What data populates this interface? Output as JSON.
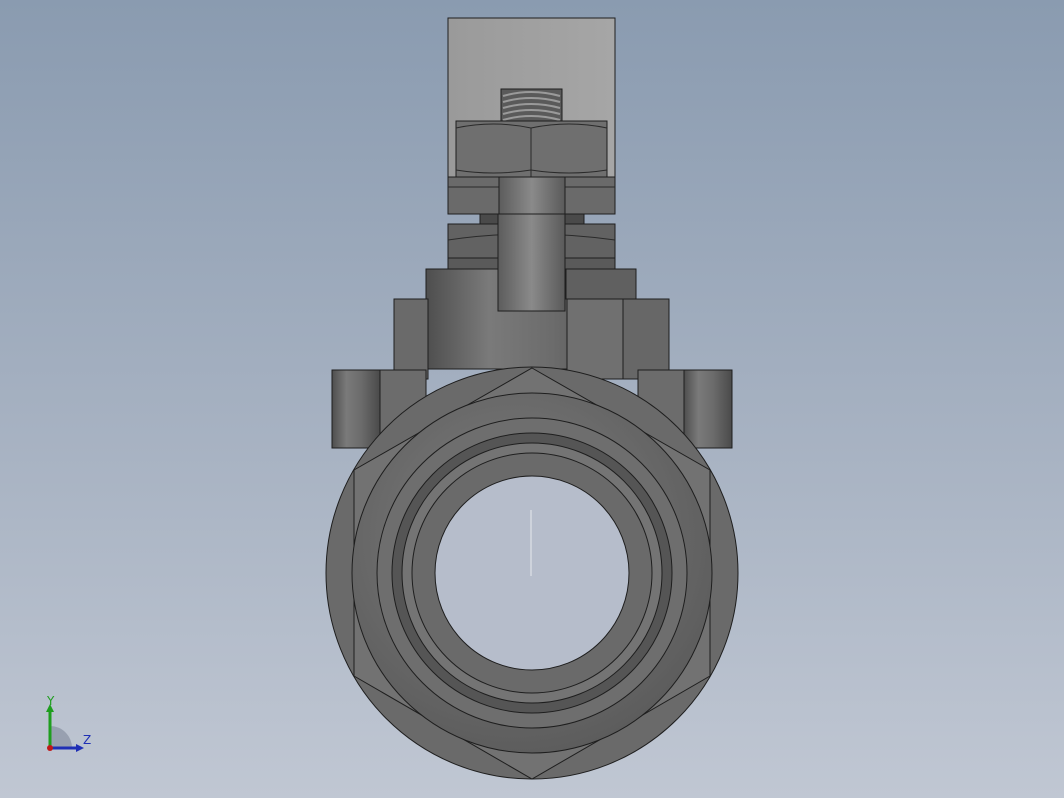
{
  "viewport": {
    "background_top": "#8a9bb0",
    "background_bottom": "#c0c7d3"
  },
  "model": {
    "part_color": "#6b6b6b",
    "edge_color": "#1e1e1e",
    "bore_color": "#b6bdcb"
  },
  "triad": {
    "y_label": "Y",
    "z_label": "Z",
    "y_color": "#1e9e1e",
    "z_color": "#1f2fb5",
    "origin_color": "#c01818"
  }
}
